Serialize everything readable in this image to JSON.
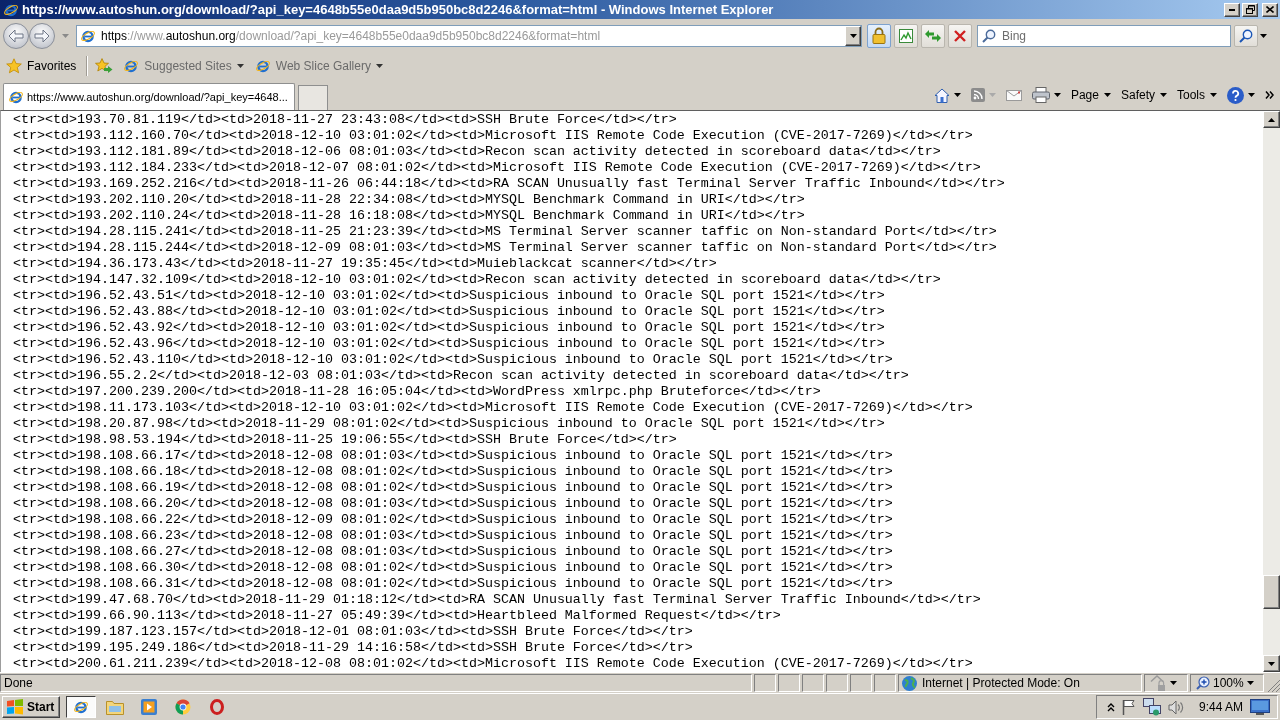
{
  "window": {
    "title": "https://www.autoshun.org/download/?api_key=4648b55e0daa9d5b950bc8d2246&format=html - Windows Internet Explorer"
  },
  "address_bar": {
    "url_parts": [
      {
        "text": "https",
        "highlighted": true
      },
      {
        "text": "://www.",
        "highlighted": false
      },
      {
        "text": "autoshun.org",
        "highlighted": true
      },
      {
        "text": "/download/?api_key=4648b55e0daa9d5b950bc8d2246&format=html",
        "highlighted": false
      }
    ]
  },
  "search": {
    "placeholder": "Bing"
  },
  "favorites_bar": {
    "label": "Favorites",
    "items": [
      {
        "label": "Suggested Sites"
      },
      {
        "label": "Web Slice Gallery"
      }
    ]
  },
  "tabs": [
    {
      "label": "https://www.autoshun.org/download/?api_key=4648...",
      "selected": true
    }
  ],
  "command_bar": {
    "menus": [
      {
        "label": "Page"
      },
      {
        "label": "Safety"
      },
      {
        "label": "Tools"
      }
    ]
  },
  "page": {
    "lines": [
      "<tr><td>193.70.81.119</td><td>2018-11-27 23:43:08</td><td>SSH Brute Force</td></tr>",
      "<tr><td>193.112.160.70</td><td>2018-12-10 03:01:02</td><td>Microsoft IIS Remote Code Execution (CVE-2017-7269)</td></tr>",
      "<tr><td>193.112.181.89</td><td>2018-12-06 08:01:03</td><td>Recon scan activity detected in scoreboard data</td></tr>",
      "<tr><td>193.112.184.233</td><td>2018-12-07 08:01:02</td><td>Microsoft IIS Remote Code Execution (CVE-2017-7269)</td></tr>",
      "<tr><td>193.169.252.216</td><td>2018-11-26 06:44:18</td><td>RA SCAN Unusually fast Terminal Server Traffic Inbound</td></tr>",
      "<tr><td>193.202.110.20</td><td>2018-11-28 22:34:08</td><td>MYSQL Benchmark Command in URI</td></tr>",
      "<tr><td>193.202.110.24</td><td>2018-11-28 16:18:08</td><td>MYSQL Benchmark Command in URI</td></tr>",
      "<tr><td>194.28.115.241</td><td>2018-11-25 21:23:39</td><td>MS Terminal Server scanner taffic on Non-standard Port</td></tr>",
      "<tr><td>194.28.115.244</td><td>2018-12-09 08:01:03</td><td>MS Terminal Server scanner taffic on Non-standard Port</td></tr>",
      "<tr><td>194.36.173.43</td><td>2018-11-27 19:35:45</td><td>Muieblackcat scanner</td></tr>",
      "<tr><td>194.147.32.109</td><td>2018-12-10 03:01:02</td><td>Recon scan activity detected in scoreboard data</td></tr>",
      "<tr><td>196.52.43.51</td><td>2018-12-10 03:01:02</td><td>Suspicious inbound to Oracle SQL port 1521</td></tr>",
      "<tr><td>196.52.43.88</td><td>2018-12-10 03:01:02</td><td>Suspicious inbound to Oracle SQL port 1521</td></tr>",
      "<tr><td>196.52.43.92</td><td>2018-12-10 03:01:02</td><td>Suspicious inbound to Oracle SQL port 1521</td></tr>",
      "<tr><td>196.52.43.96</td><td>2018-12-10 03:01:02</td><td>Suspicious inbound to Oracle SQL port 1521</td></tr>",
      "<tr><td>196.52.43.110</td><td>2018-12-10 03:01:02</td><td>Suspicious inbound to Oracle SQL port 1521</td></tr>",
      "<tr><td>196.55.2.2</td><td>2018-12-03 08:01:03</td><td>Recon scan activity detected in scoreboard data</td></tr>",
      "<tr><td>197.200.239.200</td><td>2018-11-28 16:05:04</td><td>WordPress xmlrpc.php Bruteforce</td></tr>",
      "<tr><td>198.11.173.103</td><td>2018-12-10 03:01:02</td><td>Microsoft IIS Remote Code Execution (CVE-2017-7269)</td></tr>",
      "<tr><td>198.20.87.98</td><td>2018-11-29 08:01:02</td><td>Suspicious inbound to Oracle SQL port 1521</td></tr>",
      "<tr><td>198.98.53.194</td><td>2018-11-25 19:06:55</td><td>SSH Brute Force</td></tr>",
      "<tr><td>198.108.66.17</td><td>2018-12-08 08:01:03</td><td>Suspicious inbound to Oracle SQL port 1521</td></tr>",
      "<tr><td>198.108.66.18</td><td>2018-12-08 08:01:02</td><td>Suspicious inbound to Oracle SQL port 1521</td></tr>",
      "<tr><td>198.108.66.19</td><td>2018-12-08 08:01:02</td><td>Suspicious inbound to Oracle SQL port 1521</td></tr>",
      "<tr><td>198.108.66.20</td><td>2018-12-08 08:01:03</td><td>Suspicious inbound to Oracle SQL port 1521</td></tr>",
      "<tr><td>198.108.66.22</td><td>2018-12-09 08:01:02</td><td>Suspicious inbound to Oracle SQL port 1521</td></tr>",
      "<tr><td>198.108.66.23</td><td>2018-12-08 08:01:03</td><td>Suspicious inbound to Oracle SQL port 1521</td></tr>",
      "<tr><td>198.108.66.27</td><td>2018-12-08 08:01:03</td><td>Suspicious inbound to Oracle SQL port 1521</td></tr>",
      "<tr><td>198.108.66.30</td><td>2018-12-08 08:01:02</td><td>Suspicious inbound to Oracle SQL port 1521</td></tr>",
      "<tr><td>198.108.66.31</td><td>2018-12-08 08:01:02</td><td>Suspicious inbound to Oracle SQL port 1521</td></tr>",
      "<tr><td>199.47.68.70</td><td>2018-11-29 01:18:12</td><td>RA SCAN Unusually fast Terminal Server Traffic Inbound</td></tr>",
      "<tr><td>199.66.90.113</td><td>2018-11-27 05:49:39</td><td>Heartbleed Malformed Request</td></tr>",
      "<tr><td>199.187.123.157</td><td>2018-12-01 08:01:03</td><td>SSH Brute Force</td></tr>",
      "<tr><td>199.195.249.186</td><td>2018-11-29 14:16:58</td><td>SSH Brute Force</td></tr>",
      "<tr><td>200.61.211.239</td><td>2018-12-08 08:01:02</td><td>Microsoft IIS Remote Code Execution (CVE-2017-7269)</td></tr>"
    ]
  },
  "status_bar": {
    "text": "Done",
    "zone": "Internet | Protected Mode: On",
    "zoom": "100%"
  },
  "taskbar": {
    "start_label": "Start",
    "apps": [
      {
        "kind": "ie",
        "active": true
      },
      {
        "kind": "explorer",
        "active": false
      },
      {
        "kind": "media",
        "active": false
      },
      {
        "kind": "chrome",
        "active": false
      },
      {
        "kind": "opera",
        "active": false
      }
    ],
    "clock": "9:44 AM"
  }
}
